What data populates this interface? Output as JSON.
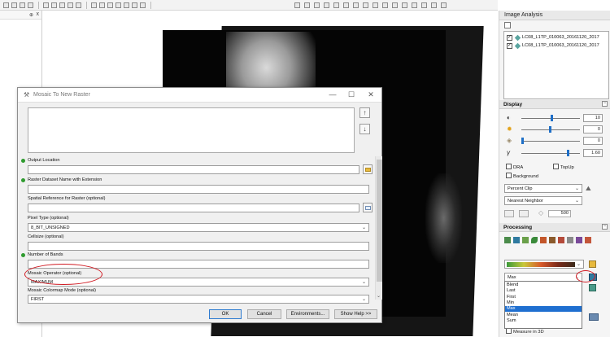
{
  "dialog": {
    "title": "Mosaic To New Raster",
    "minimize": "—",
    "maximize": "☐",
    "close": "✕",
    "move_up": "↑",
    "move_down": "↓",
    "fields": [
      {
        "label": "Output Location",
        "value": "",
        "required": true
      },
      {
        "label": "Raster Dataset Name with Extension",
        "value": "",
        "required": true
      },
      {
        "label": "Spatial Reference for Raster (optional)",
        "value": "",
        "required": false
      },
      {
        "label": "Pixel Type (optional)",
        "value": "8_BIT_UNSIGNED",
        "required": false
      },
      {
        "label": "Cellsize (optional)",
        "value": "",
        "required": false
      },
      {
        "label": "Number of Bands",
        "value": "",
        "required": true
      },
      {
        "label": "Mosaic Operator (optional)",
        "value": "MAXIMUM",
        "required": false
      },
      {
        "label": "Mosaic Colormap Mode (optional)",
        "value": "FIRST",
        "required": false
      }
    ],
    "buttons": {
      "ok": "OK",
      "cancel": "Cancel",
      "environments": "Environments...",
      "show_help": "Show Help >>"
    }
  },
  "left_panel": {
    "pin": "⊕",
    "close": "x"
  },
  "image_analysis": {
    "title": "Image Analysis",
    "layers": [
      {
        "name": "LC08_L1TP_010063_20161120_2017",
        "checked": true
      },
      {
        "name": "LC08_L1TP_010063_20161120_2017",
        "checked": true
      }
    ],
    "display": {
      "header": "Display",
      "collapse": "−",
      "sliders": [
        {
          "icon": "contrast-icon",
          "value": "10",
          "level": 0.5
        },
        {
          "icon": "brightness-icon",
          "value": "0",
          "level": 0.48
        },
        {
          "icon": "transparency-icon",
          "value": "0",
          "level": 0.0
        },
        {
          "icon": "gamma-icon",
          "glyph": "γ",
          "value": "1.60",
          "level": 0.78
        }
      ],
      "dra": "DRA",
      "topup": "TopUp",
      "background": "Background",
      "stretch": "Percent Clip",
      "resample": "Nearest Neighbor",
      "quality": "500"
    },
    "processing": {
      "header": "Processing",
      "collapse": "−",
      "operator_selected": "Max",
      "options": [
        "Blend",
        "Last",
        "First",
        "Min",
        "Max",
        "Mean",
        "Sum"
      ],
      "selected_option": "Max",
      "measure": "Measure in 3D"
    }
  },
  "colors": {
    "annotation_red": "#d01a22",
    "selection_blue": "#1f6fd0",
    "required_green": "#2f9b2f"
  }
}
